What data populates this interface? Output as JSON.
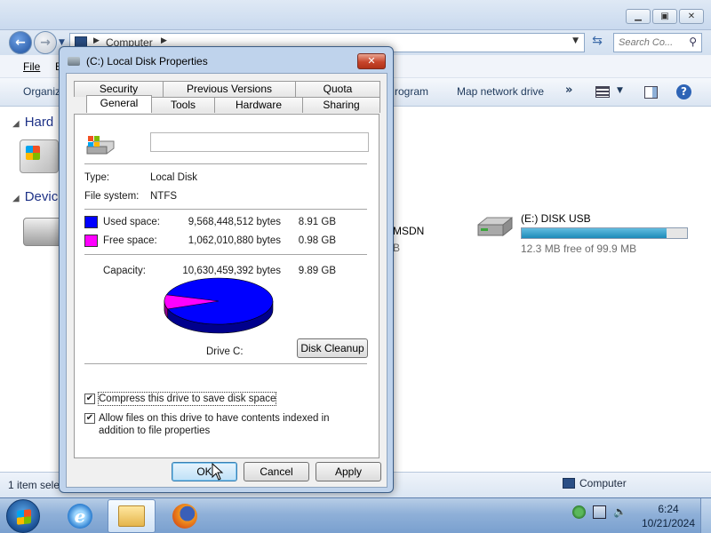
{
  "explorer": {
    "address_crumb": "Computer",
    "search_placeholder": "Search Co...",
    "menu": {
      "file": "File",
      "edit": "E"
    },
    "toolbar": {
      "organize": "Organiz",
      "program": "rogram",
      "map_drive": "Map network drive"
    },
    "groups": {
      "hard_disks": "Hard",
      "devices": "Devic"
    },
    "drives": {
      "msdn_name": "MSDN",
      "msdn_frag": "B",
      "usb_name": "(E:) DISK USB",
      "usb_free": "12.3 MB free of 99.9 MB",
      "usb_used_fraction": 0.877
    },
    "status": {
      "left": "1 item sele",
      "right": "Computer"
    }
  },
  "dialog": {
    "title": "(C:) Local Disk Properties",
    "tabs": {
      "security": "Security",
      "previous_versions": "Previous Versions",
      "quota": "Quota",
      "general": "General",
      "tools": "Tools",
      "hardware": "Hardware",
      "sharing": "Sharing"
    },
    "drive_label_value": "",
    "type_label": "Type:",
    "type_value": "Local Disk",
    "fs_label": "File system:",
    "fs_value": "NTFS",
    "used_label": "Used space:",
    "used_bytes": "9,568,448,512 bytes",
    "used_gb": "8.91 GB",
    "free_label": "Free space:",
    "free_bytes": "1,062,010,880 bytes",
    "free_gb": "0.98 GB",
    "capacity_label": "Capacity:",
    "capacity_bytes": "10,630,459,392 bytes",
    "capacity_gb": "9.89 GB",
    "drive_name": "Drive C:",
    "cleanup": "Disk Cleanup",
    "compress_label": "Compress this drive to save disk space",
    "compress_checked": true,
    "index_label": "Allow files on this drive to have contents indexed in addition to file properties",
    "index_checked": true,
    "ok": "OK",
    "cancel": "Cancel",
    "apply": "Apply",
    "used_color": "#0000ff",
    "free_color": "#ff00ff",
    "used_fraction": 0.9
  },
  "taskbar": {
    "time": "6:24",
    "date": "10/21/2024"
  }
}
